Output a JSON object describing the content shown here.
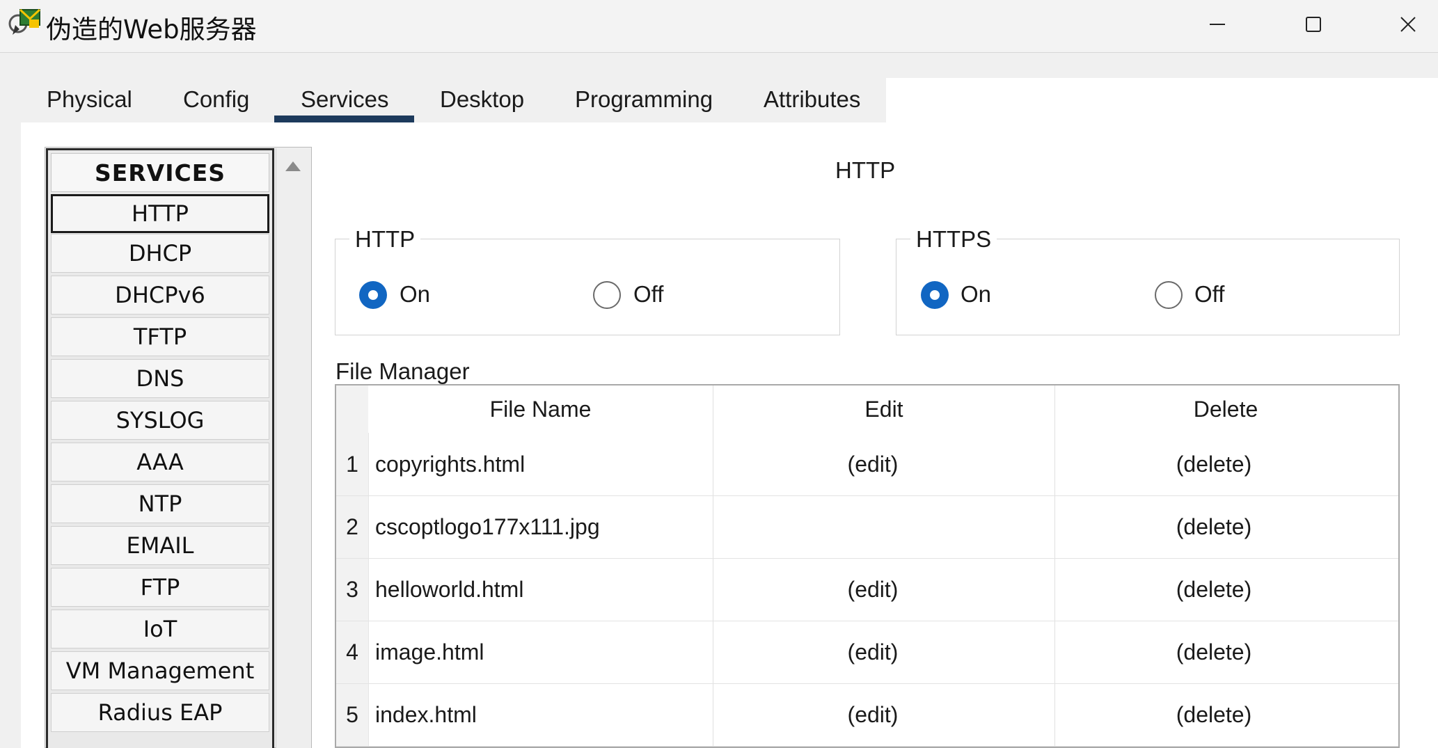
{
  "window": {
    "title": "伪造的Web服务器"
  },
  "tabs": [
    {
      "label": "Physical"
    },
    {
      "label": "Config"
    },
    {
      "label": "Services"
    },
    {
      "label": "Desktop"
    },
    {
      "label": "Programming"
    },
    {
      "label": "Attributes"
    }
  ],
  "active_tab": "Services",
  "services": {
    "header": "SERVICES",
    "items": [
      {
        "label": "HTTP"
      },
      {
        "label": "DHCP"
      },
      {
        "label": "DHCPv6"
      },
      {
        "label": "TFTP"
      },
      {
        "label": "DNS"
      },
      {
        "label": "SYSLOG"
      },
      {
        "label": "AAA"
      },
      {
        "label": "NTP"
      },
      {
        "label": "EMAIL"
      },
      {
        "label": "FTP"
      },
      {
        "label": "IoT"
      },
      {
        "label": "VM Management"
      },
      {
        "label": "Radius EAP"
      }
    ],
    "selected": "HTTP"
  },
  "http_page": {
    "heading": "HTTP",
    "http_group": {
      "legend": "HTTP",
      "on_label": "On",
      "off_label": "Off",
      "value": "On"
    },
    "https_group": {
      "legend": "HTTPS",
      "on_label": "On",
      "off_label": "Off",
      "value": "On"
    },
    "file_manager": {
      "label": "File Manager",
      "columns": [
        "File Name",
        "Edit",
        "Delete"
      ],
      "rows": [
        {
          "num": "1",
          "name": "copyrights.html",
          "edit": "(edit)",
          "delete": "(delete)"
        },
        {
          "num": "2",
          "name": "cscoptlogo177x111.jpg",
          "edit": "",
          "delete": "(delete)"
        },
        {
          "num": "3",
          "name": "helloworld.html",
          "edit": "(edit)",
          "delete": "(delete)"
        },
        {
          "num": "4",
          "name": "image.html",
          "edit": "(edit)",
          "delete": "(delete)"
        },
        {
          "num": "5",
          "name": "index.html",
          "edit": "(edit)",
          "delete": "(delete)"
        }
      ]
    }
  },
  "colors": {
    "accent": "#1166c2",
    "tab_underline": "#1d3a5c"
  },
  "icons": [
    "app-envelope-icon",
    "minimize-icon",
    "maximize-icon",
    "close-icon",
    "scroll-up-arrow-icon"
  ]
}
